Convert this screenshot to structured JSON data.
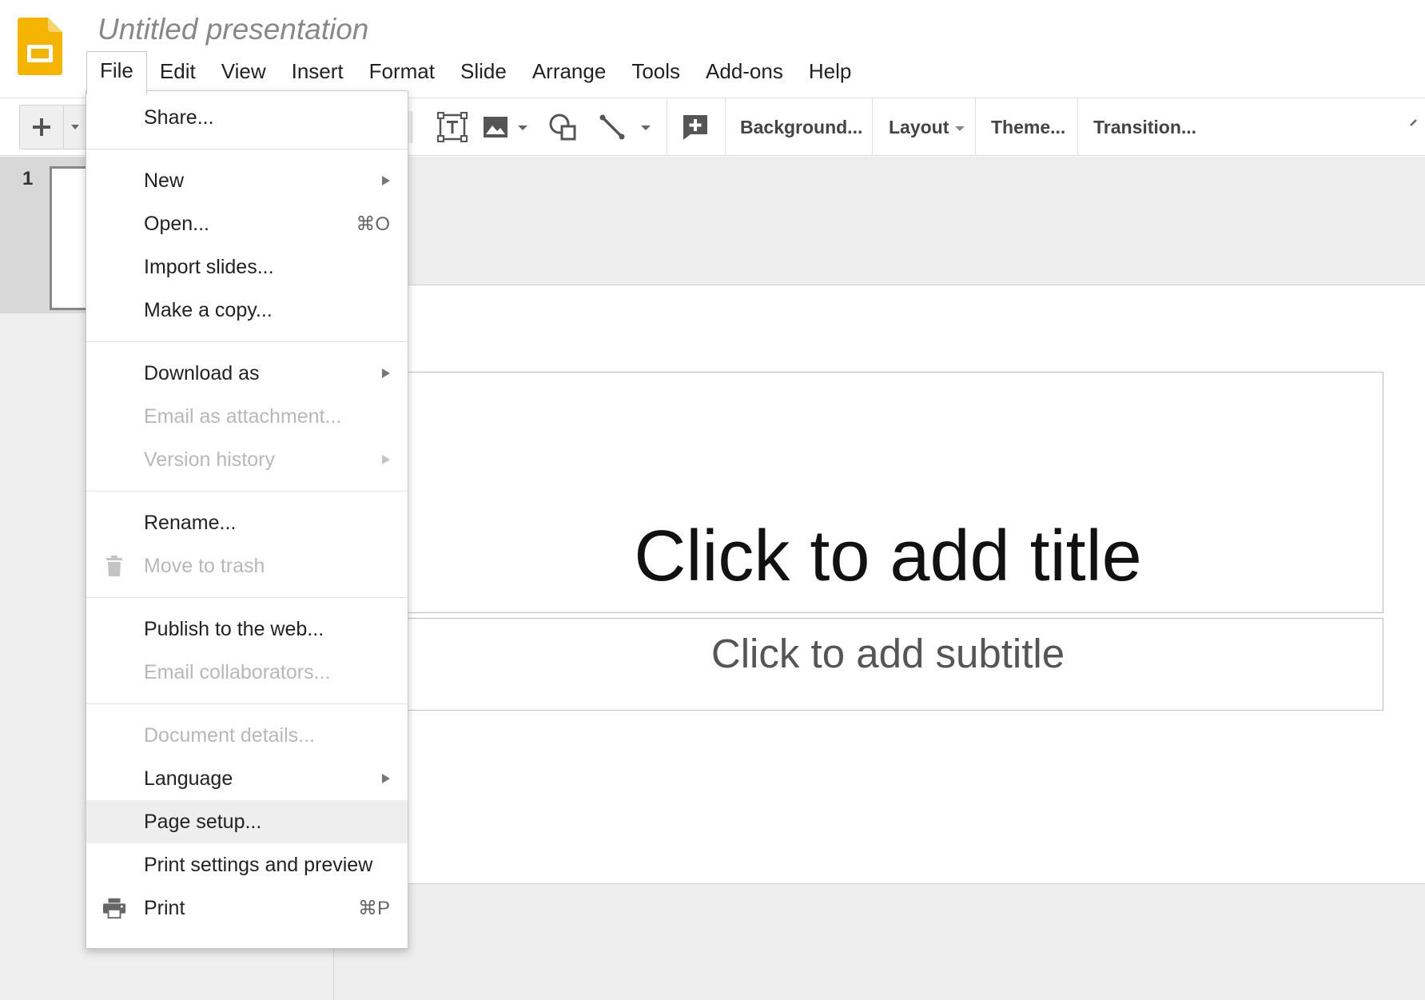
{
  "app": {
    "title": "Untitled presentation"
  },
  "menubar": {
    "items": [
      "File",
      "Edit",
      "View",
      "Insert",
      "Format",
      "Slide",
      "Arrange",
      "Tools",
      "Add-ons",
      "Help"
    ]
  },
  "toolbar": {
    "buttons": {
      "background": "Background...",
      "layout": "Layout",
      "theme": "Theme...",
      "transition": "Transition..."
    },
    "icons": [
      "plus-icon",
      "text-box-icon",
      "image-icon",
      "shape-icon",
      "line-icon",
      "comment-icon"
    ]
  },
  "filmstrip": {
    "slide_number": "1"
  },
  "slide": {
    "title_placeholder": "Click to add title",
    "subtitle_placeholder": "Click to add subtitle"
  },
  "file_menu": {
    "share": "Share...",
    "new": "New",
    "open": "Open...",
    "open_shortcut": "⌘O",
    "import_slides": "Import slides...",
    "make_copy": "Make a copy...",
    "download_as": "Download as",
    "email_attachment": "Email as attachment...",
    "version_history": "Version history",
    "rename": "Rename...",
    "move_to_trash": "Move to trash",
    "publish_web": "Publish to the web...",
    "email_collaborators": "Email collaborators...",
    "document_details": "Document details...",
    "language": "Language",
    "page_setup": "Page setup...",
    "print_settings": "Print settings and preview",
    "print": "Print",
    "print_shortcut": "⌘P"
  },
  "colors": {
    "brand_yellow": "#F4B400",
    "menu_highlight": "#EEEEEE",
    "disabled_text": "#B8B8B8"
  }
}
